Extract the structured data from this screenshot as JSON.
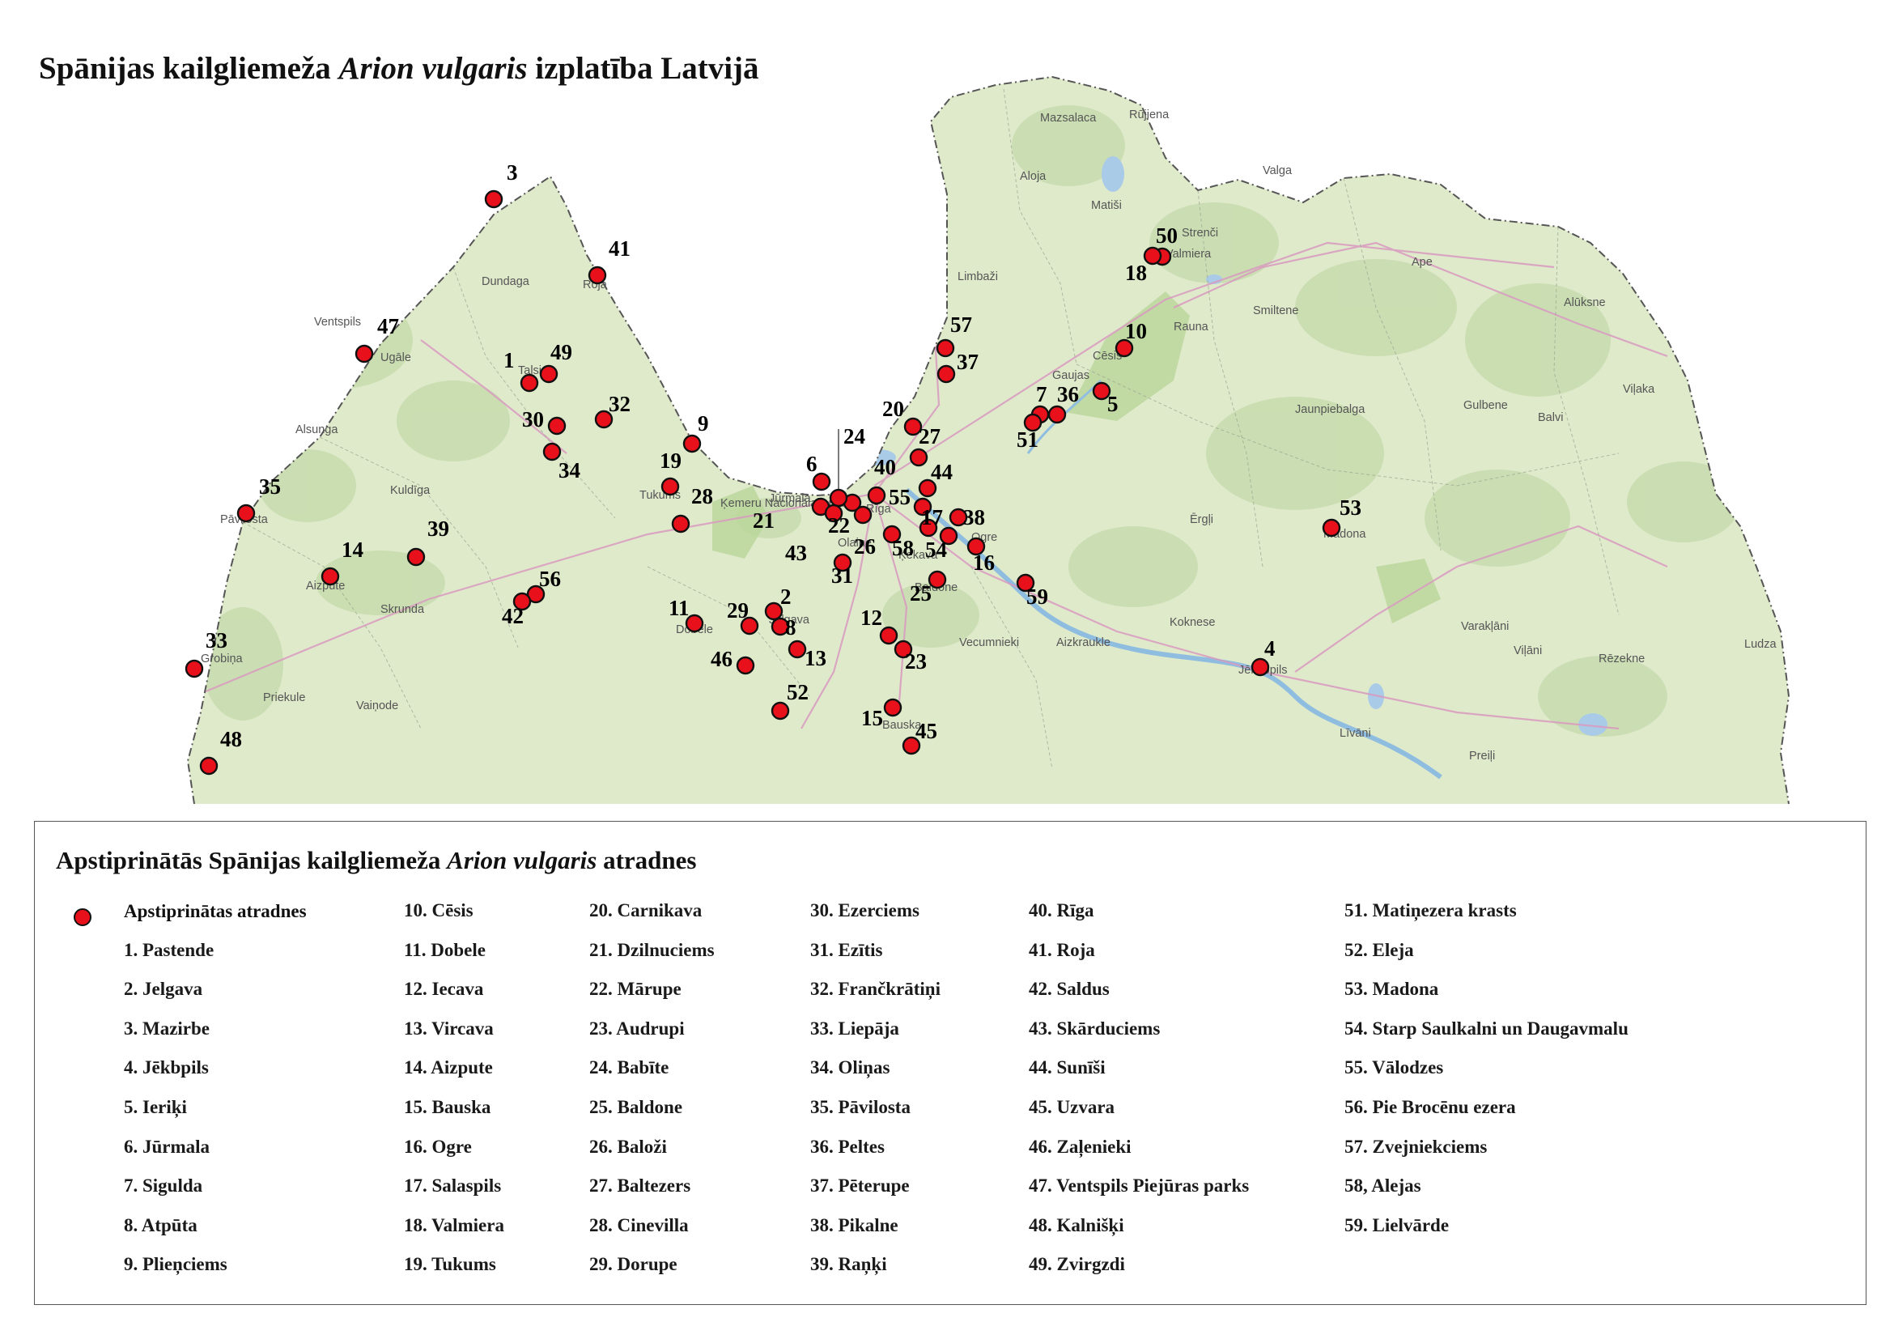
{
  "title": {
    "prefix": "Spānijas kailgliemeža ",
    "species": "Arion vulgaris",
    "suffix": " izplatība Latvijā"
  },
  "legend": {
    "title_prefix": "Apstiprinātās Spānijas kailgliemeža ",
    "title_species": "Arion vulgaris",
    "title_suffix": " atradnes",
    "symbol_label": "Apstiprinātas atradnes",
    "symbol_color": "#e8101a",
    "columns": [
      [
        "1. Pastende",
        "2. Jelgava",
        "3. Mazirbe",
        "4. Jēkbpils",
        "5. Ieriķi",
        "6. Jūrmala",
        "7. Sigulda",
        "8. Atpūta",
        "9. Plieņciems"
      ],
      [
        "10. Cēsis",
        "11. Dobele",
        "12. Iecava",
        "13. Vircava",
        "14. Aizpute",
        "15. Bauska",
        "16. Ogre",
        "17. Salaspils",
        "18. Valmiera",
        "19. Tukums"
      ],
      [
        "20. Carnikava",
        "21. Dzilnuciems",
        "22. Mārupe",
        "23. Audrupi",
        "24. Babīte",
        "25. Baldone",
        "26. Baloži",
        "27. Baltezers",
        "28. Cinevilla",
        "29. Dorupe"
      ],
      [
        "30. Ezerciems",
        "31. Ezītis",
        "32. Frančkrātiņi",
        "33. Liepāja",
        "34. Oliņas",
        "35. Pāvilosta",
        "36. Peltes",
        "37. Pēterupe",
        "38. Pikalne",
        "39. Raņķi"
      ],
      [
        "40. Rīga",
        "41. Roja",
        "42. Saldus",
        "43. Skārduciems",
        "44. Sunīši",
        "45. Uzvara",
        "46. Zaļenieki",
        "47. Ventspils Piejūras parks",
        "48. Kalnišķi",
        "49. Zvirgzdi"
      ],
      [
        "51. Matiņezera  krasts",
        "52. Eleja",
        "53. Madona",
        "54. Starp Saulkalni un Daugavmalu",
        "55. Vālodzes",
        "56. Pie Brocēnu ezera",
        "57. Zvejniekciems",
        "58, Alejas",
        "59. Lielvārde"
      ]
    ]
  },
  "map": {
    "land_color": "#dfeacb",
    "forest_color": "#c5dcab",
    "water_color": "#a9cbe8",
    "road_color": "#d99ac0",
    "border_color": "#555555",
    "place_names": [
      "Mazsalaca",
      "Rūjiena",
      "Valga",
      "Aloja",
      "Matiši",
      "Strenči",
      "Valmiera",
      "Ape",
      "Limbaži",
      "Alūksne",
      "Smiltene",
      "Rauna",
      "Cēsis",
      "Gaujas",
      "Gulbene",
      "Viļaka",
      "Balvi",
      "Jaunpiebalga",
      "Dundaga",
      "Roja",
      "Ventspils",
      "Ugāle",
      "Talsi",
      "Alsunga",
      "Kuldīga",
      "Pāvilosta",
      "Aizpute",
      "Skrunda",
      "Grobiņa",
      "Priekule",
      "Vaiņode",
      "Tukums",
      "Ķemeru Nacionālais parks",
      "Jūrmala",
      "Rīga",
      "Olaine",
      "Ērgļi",
      "Madona",
      "Ogre",
      "Ķekava",
      "Baldone",
      "Dobele",
      "Jelgava",
      "Vecumnieki",
      "Aizkraukle",
      "Koknese",
      "Jēkabpils",
      "Varakļāni",
      "Viļāni",
      "Rēzekne",
      "Ludza",
      "Līvāni",
      "Preiļi",
      "Bauska"
    ],
    "sites": [
      {
        "n": "3"
      },
      {
        "n": "41"
      },
      {
        "n": "47"
      },
      {
        "n": "1"
      },
      {
        "n": "49"
      },
      {
        "n": "30"
      },
      {
        "n": "32"
      },
      {
        "n": "34"
      },
      {
        "n": "9"
      },
      {
        "n": "19"
      },
      {
        "n": "28"
      },
      {
        "n": "35"
      },
      {
        "n": "39"
      },
      {
        "n": "14"
      },
      {
        "n": "56"
      },
      {
        "n": "42"
      },
      {
        "n": "33"
      },
      {
        "n": "48"
      },
      {
        "n": "11"
      },
      {
        "n": "29"
      },
      {
        "n": "2"
      },
      {
        "n": "8"
      },
      {
        "n": "46"
      },
      {
        "n": "13"
      },
      {
        "n": "52"
      },
      {
        "n": "6"
      },
      {
        "n": "21"
      },
      {
        "n": "43"
      },
      {
        "n": "22"
      },
      {
        "n": "24"
      },
      {
        "n": "40"
      },
      {
        "n": "26"
      },
      {
        "n": "31"
      },
      {
        "n": "20"
      },
      {
        "n": "27"
      },
      {
        "n": "44"
      },
      {
        "n": "55"
      },
      {
        "n": "17"
      },
      {
        "n": "38"
      },
      {
        "n": "58"
      },
      {
        "n": "54"
      },
      {
        "n": "16"
      },
      {
        "n": "25"
      },
      {
        "n": "59"
      },
      {
        "n": "12"
      },
      {
        "n": "23"
      },
      {
        "n": "15"
      },
      {
        "n": "45"
      },
      {
        "n": "57"
      },
      {
        "n": "37"
      },
      {
        "n": "50"
      },
      {
        "n": "18"
      },
      {
        "n": "10"
      },
      {
        "n": "7"
      },
      {
        "n": "36"
      },
      {
        "n": "5"
      },
      {
        "n": "51"
      },
      {
        "n": "53"
      },
      {
        "n": "4"
      }
    ]
  }
}
